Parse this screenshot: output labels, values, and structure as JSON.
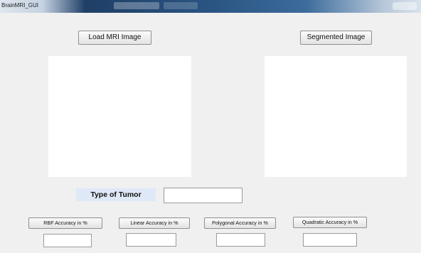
{
  "window": {
    "title": "BrainMRI_GUI"
  },
  "buttons": {
    "load_mri": "Load MRI Image",
    "segmented": "Segmented Image"
  },
  "tumor": {
    "label": "Type of Tumor",
    "value": ""
  },
  "accuracy": [
    {
      "label": "RBF Accuracy in %",
      "value": ""
    },
    {
      "label": "Linear Accuracy in %",
      "value": ""
    },
    {
      "label": "Polygonal Accuracy in %",
      "value": ""
    },
    {
      "label": "Quadratic Accuracy in %",
      "value": ""
    }
  ]
}
